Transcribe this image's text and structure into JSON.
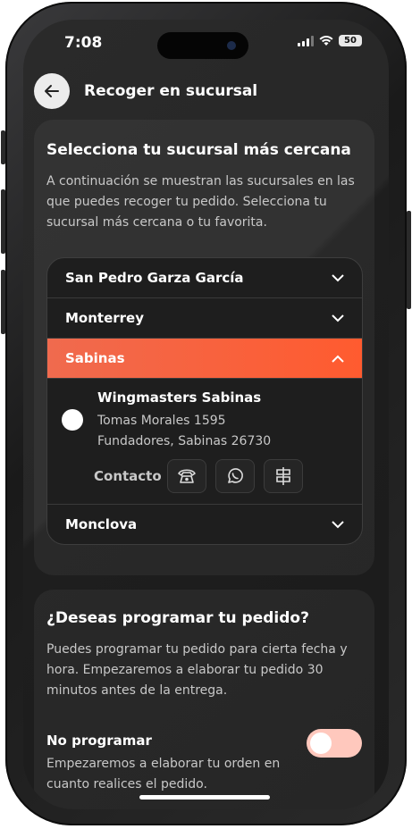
{
  "status": {
    "time": "7:08",
    "battery": "50"
  },
  "header": {
    "title": "Recoger en sucursal",
    "back_icon": "arrow-left-icon"
  },
  "branches_card": {
    "title": "Selecciona tu sucursal más cercana",
    "description": "A continuación se muestran las sucursales en las que puedes recoger tu pedido. Selecciona tu sucursal más cercana o tu favorita.",
    "cities": [
      "San Pedro Garza García",
      "Monterrey",
      "Sabinas",
      "Monclova"
    ],
    "selected_city": "Sabinas",
    "branch": {
      "name": "Wingmasters Sabinas",
      "address_line1": "Tomas Morales 1595",
      "address_line2": "Fundadores, Sabinas 26730",
      "contact_label": "Contacto",
      "contact_icons": [
        "phone-icon",
        "whatsapp-icon",
        "directions-icon"
      ]
    }
  },
  "schedule_card": {
    "title": "¿Deseas programar tu pedido?",
    "description": "Puedes programar tu pedido para cierta fecha y hora. Empezaremos a elaborar tu pedido 30 minutos antes de la entrega.",
    "option_label": "No programar",
    "option_description": "Empezaremos a elaborar tu orden en cuanto realices el pedido.",
    "toggle_on": false
  },
  "colors": {
    "accent": "#ff5b2f",
    "toggle_track": "#ffc8bd"
  }
}
